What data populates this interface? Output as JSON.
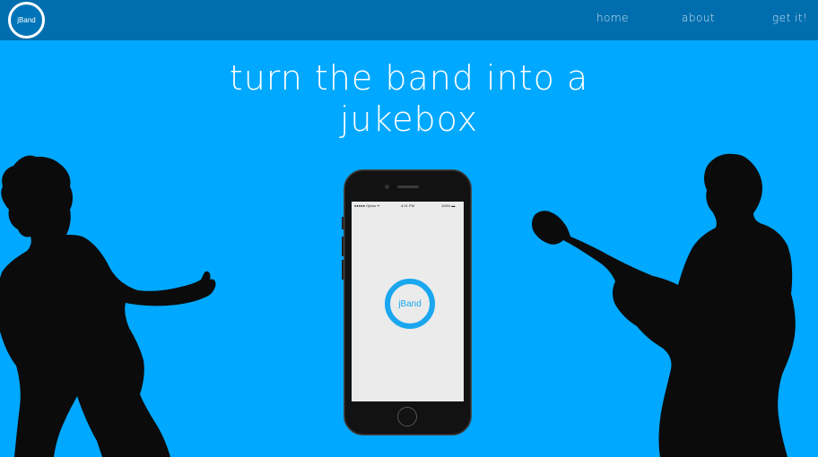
{
  "navbar": {
    "logo_text": "jBand",
    "links": [
      "home",
      "about",
      "get it!"
    ]
  },
  "hero": {
    "headline_line1": "turn the band into a",
    "headline_line2": "jukebox"
  },
  "phone": {
    "status_carrier": "●●●●● Optus ᯤ",
    "status_time": "4:21 PM",
    "status_battery": "100% ▬",
    "app_logo_text": "jBand"
  },
  "colors": {
    "background": "#00a8ff",
    "navbar": "#006eae",
    "accent": "#1aa7ef"
  }
}
